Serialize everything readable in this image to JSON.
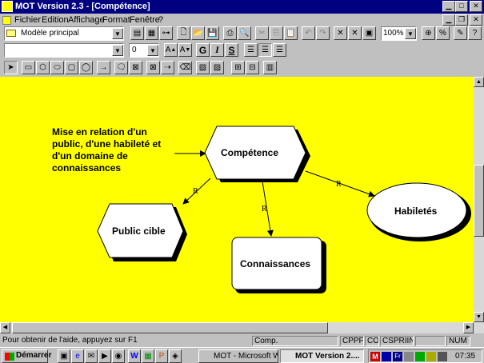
{
  "window": {
    "title": "MOT Version 2.3 - [Compétence]"
  },
  "menu": [
    {
      "label": "Fichier"
    },
    {
      "label": "Edition"
    },
    {
      "label": "Affichage"
    },
    {
      "label": "Format"
    },
    {
      "label": "Fenêtre"
    },
    {
      "label": "?"
    }
  ],
  "toolbar1": {
    "model_select": "Modèle principal",
    "zoom": "100%"
  },
  "toolbar2": {
    "font_select": "",
    "size_select": "0",
    "bold": "G",
    "italic": "I",
    "strike": "S"
  },
  "diagram": {
    "note": "Mise en relation d'un public, d'une habileté et d'un domaine de connaissances",
    "shapes": {
      "competence": "Compétence",
      "public": "Public cible",
      "habiletes": "Habiletés",
      "connaissances": "Connaissances"
    },
    "link_labels": [
      "R",
      "R",
      "R"
    ]
  },
  "status": {
    "help": "Pour obtenir de l'aide, appuyez sur F1",
    "comp": "Comp.",
    "cppfa": "CPPFA",
    "co": "CO",
    "csprin": "CSPRIIN",
    "num": "NUM"
  },
  "taskbar": {
    "start": "Démarrer",
    "tasks": [
      {
        "label": "MOT - Microsoft Word"
      },
      {
        "label": "MOT Version 2...."
      }
    ],
    "clock": "07:35"
  },
  "colors": {
    "canvas": "#ffff00",
    "titlebar": "#000080"
  }
}
